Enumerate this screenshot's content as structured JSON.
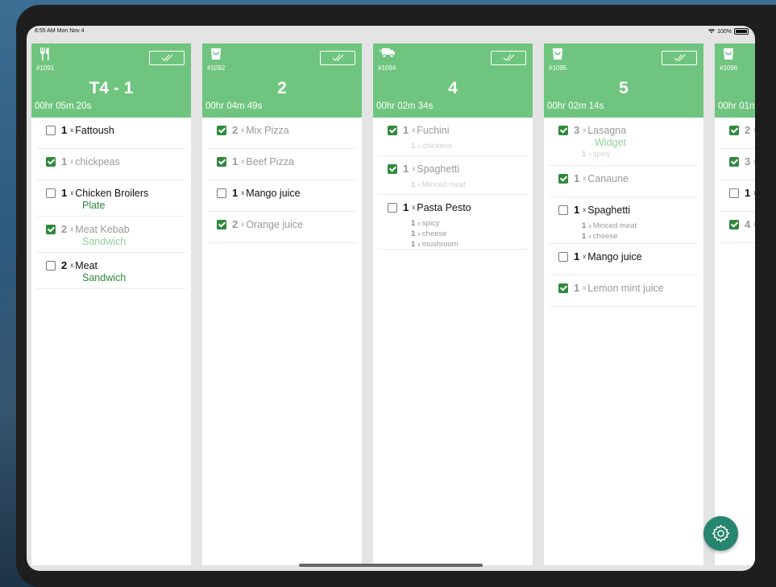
{
  "status_bar": {
    "time": "8:55 AM  Mon Nov 4",
    "battery": "100%"
  },
  "orders": [
    {
      "icon": "cutlery-icon",
      "order_no": "#1091",
      "title": "T4 - 1",
      "timer": "00hr 05m 20s",
      "items": [
        {
          "qty": "1",
          "name": "Fattoush",
          "checked": false
        },
        {
          "qty": "1",
          "name": "chickpeas",
          "checked": true
        },
        {
          "qty": "1",
          "name": "Chicken Broilers",
          "note": "Plate",
          "checked": false
        },
        {
          "qty": "2",
          "name": "Meat Kebab",
          "note": "Sandwich",
          "checked": true
        },
        {
          "qty": "2",
          "name": "Meat",
          "note": "Sandwich",
          "checked": false
        }
      ]
    },
    {
      "icon": "takeaway-bag-icon",
      "order_no": "#1092",
      "title": "2",
      "timer": "00hr 04m 49s",
      "items": [
        {
          "qty": "2",
          "name": "Mix Pizza",
          "checked": true
        },
        {
          "qty": "1",
          "name": "Beef Pizza",
          "checked": true
        },
        {
          "qty": "1",
          "name": "Mango juice",
          "checked": false
        },
        {
          "qty": "2",
          "name": "Orange juice",
          "checked": true
        }
      ]
    },
    {
      "icon": "delivery-truck-icon",
      "order_no": "#1094",
      "title": "4",
      "timer": "00hr 02m 34s",
      "items": [
        {
          "qty": "1",
          "name": "Fuchini",
          "checked": true,
          "modifiers": [
            {
              "qty": "1",
              "name": "chickens"
            }
          ]
        },
        {
          "qty": "1",
          "name": "Spaghetti",
          "checked": true,
          "modifiers": [
            {
              "qty": "1",
              "name": "Minced meat"
            }
          ]
        },
        {
          "qty": "1",
          "name": "Pasta Pesto",
          "checked": false,
          "modifiers": [
            {
              "qty": "1",
              "name": "spicy"
            },
            {
              "qty": "1",
              "name": "cheese"
            },
            {
              "qty": "1",
              "name": "mushroom"
            }
          ]
        }
      ]
    },
    {
      "icon": "takeaway-bag-icon",
      "order_no": "#1095",
      "title": "5",
      "timer": "00hr 02m 14s",
      "items": [
        {
          "qty": "3",
          "name": "Lasagna",
          "note": "Widget",
          "checked": true,
          "modifiers": [
            {
              "qty": "1",
              "name": "spicy"
            }
          ]
        },
        {
          "qty": "1",
          "name": "Canaune",
          "checked": true
        },
        {
          "qty": "1",
          "name": "Spaghetti",
          "checked": false,
          "modifiers": [
            {
              "qty": "1",
              "name": "Minced meat"
            },
            {
              "qty": "1",
              "name": "cheese"
            }
          ]
        },
        {
          "qty": "1",
          "name": "Mango juice",
          "checked": false
        },
        {
          "qty": "1",
          "name": "Lemon mint juice",
          "checked": true
        }
      ]
    },
    {
      "icon": "takeaway-bag-icon",
      "order_no": "#1096",
      "title": "",
      "timer": "00hr 01n",
      "items": [
        {
          "qty": "2",
          "name": "",
          "checked": true
        },
        {
          "qty": "3",
          "name": "",
          "checked": true
        },
        {
          "qty": "1",
          "name": "",
          "checked": false
        },
        {
          "qty": "4",
          "name": "",
          "checked": true
        }
      ]
    }
  ],
  "colors": {
    "header": "#6fc57f",
    "check": "#2f8a3c",
    "note": "#2d8a3a",
    "fab": "#26856e"
  },
  "settings_button": {
    "icon": "gear-icon"
  }
}
